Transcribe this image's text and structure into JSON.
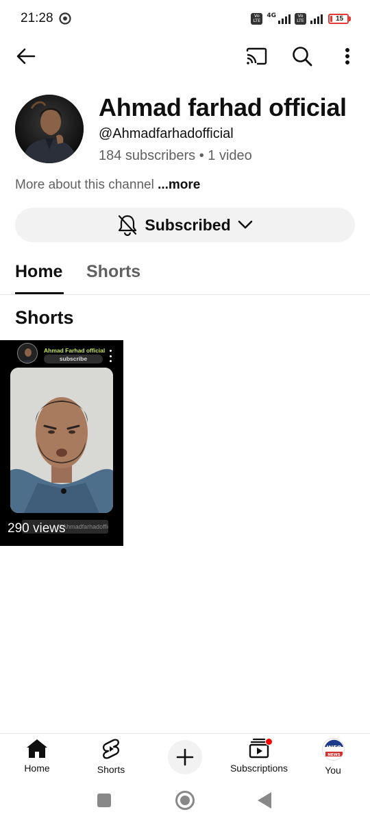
{
  "status_bar": {
    "time": "21:28",
    "chrome_icon": "chrome-icon",
    "net1": "4G",
    "volte": "Vo\nLTE",
    "battery": "15",
    "battery_color": "#e53935"
  },
  "app_bar": {
    "back_icon": "arrow-left-icon",
    "cast_icon": "cast-icon",
    "search_icon": "search-icon",
    "more_icon": "more-vert-icon"
  },
  "channel": {
    "name": "Ahmad farhad official",
    "handle": "@Ahmadfarhadofficial",
    "stats": "184 subscribers • 1 video",
    "about": "More about this channel",
    "more": "...more",
    "subscribed_label": "Subscribed",
    "bell_icon": "notifications-off-icon",
    "chevron_icon": "chevron-down-icon"
  },
  "tabs": [
    {
      "label": "Home",
      "selected": true
    },
    {
      "label": "Shorts",
      "selected": false
    }
  ],
  "section": {
    "title": "Shorts"
  },
  "short": {
    "overlay_channel": "Ahmad Farhad official",
    "overlay_subscribe": "subscribe",
    "overlay_handle": "@Ahmadfarhadofficial",
    "views": "290 views"
  },
  "bottom_nav": {
    "home": "Home",
    "shorts": "Shorts",
    "subscriptions": "Subscriptions",
    "you": "You",
    "you_avatar_text": "INFO",
    "you_avatar_sub": "NEWS"
  },
  "colors": {
    "accent": "#ff0000",
    "text": "#0f0f0f",
    "secondary_text": "#606060",
    "chip_bg": "#f2f2f2"
  }
}
